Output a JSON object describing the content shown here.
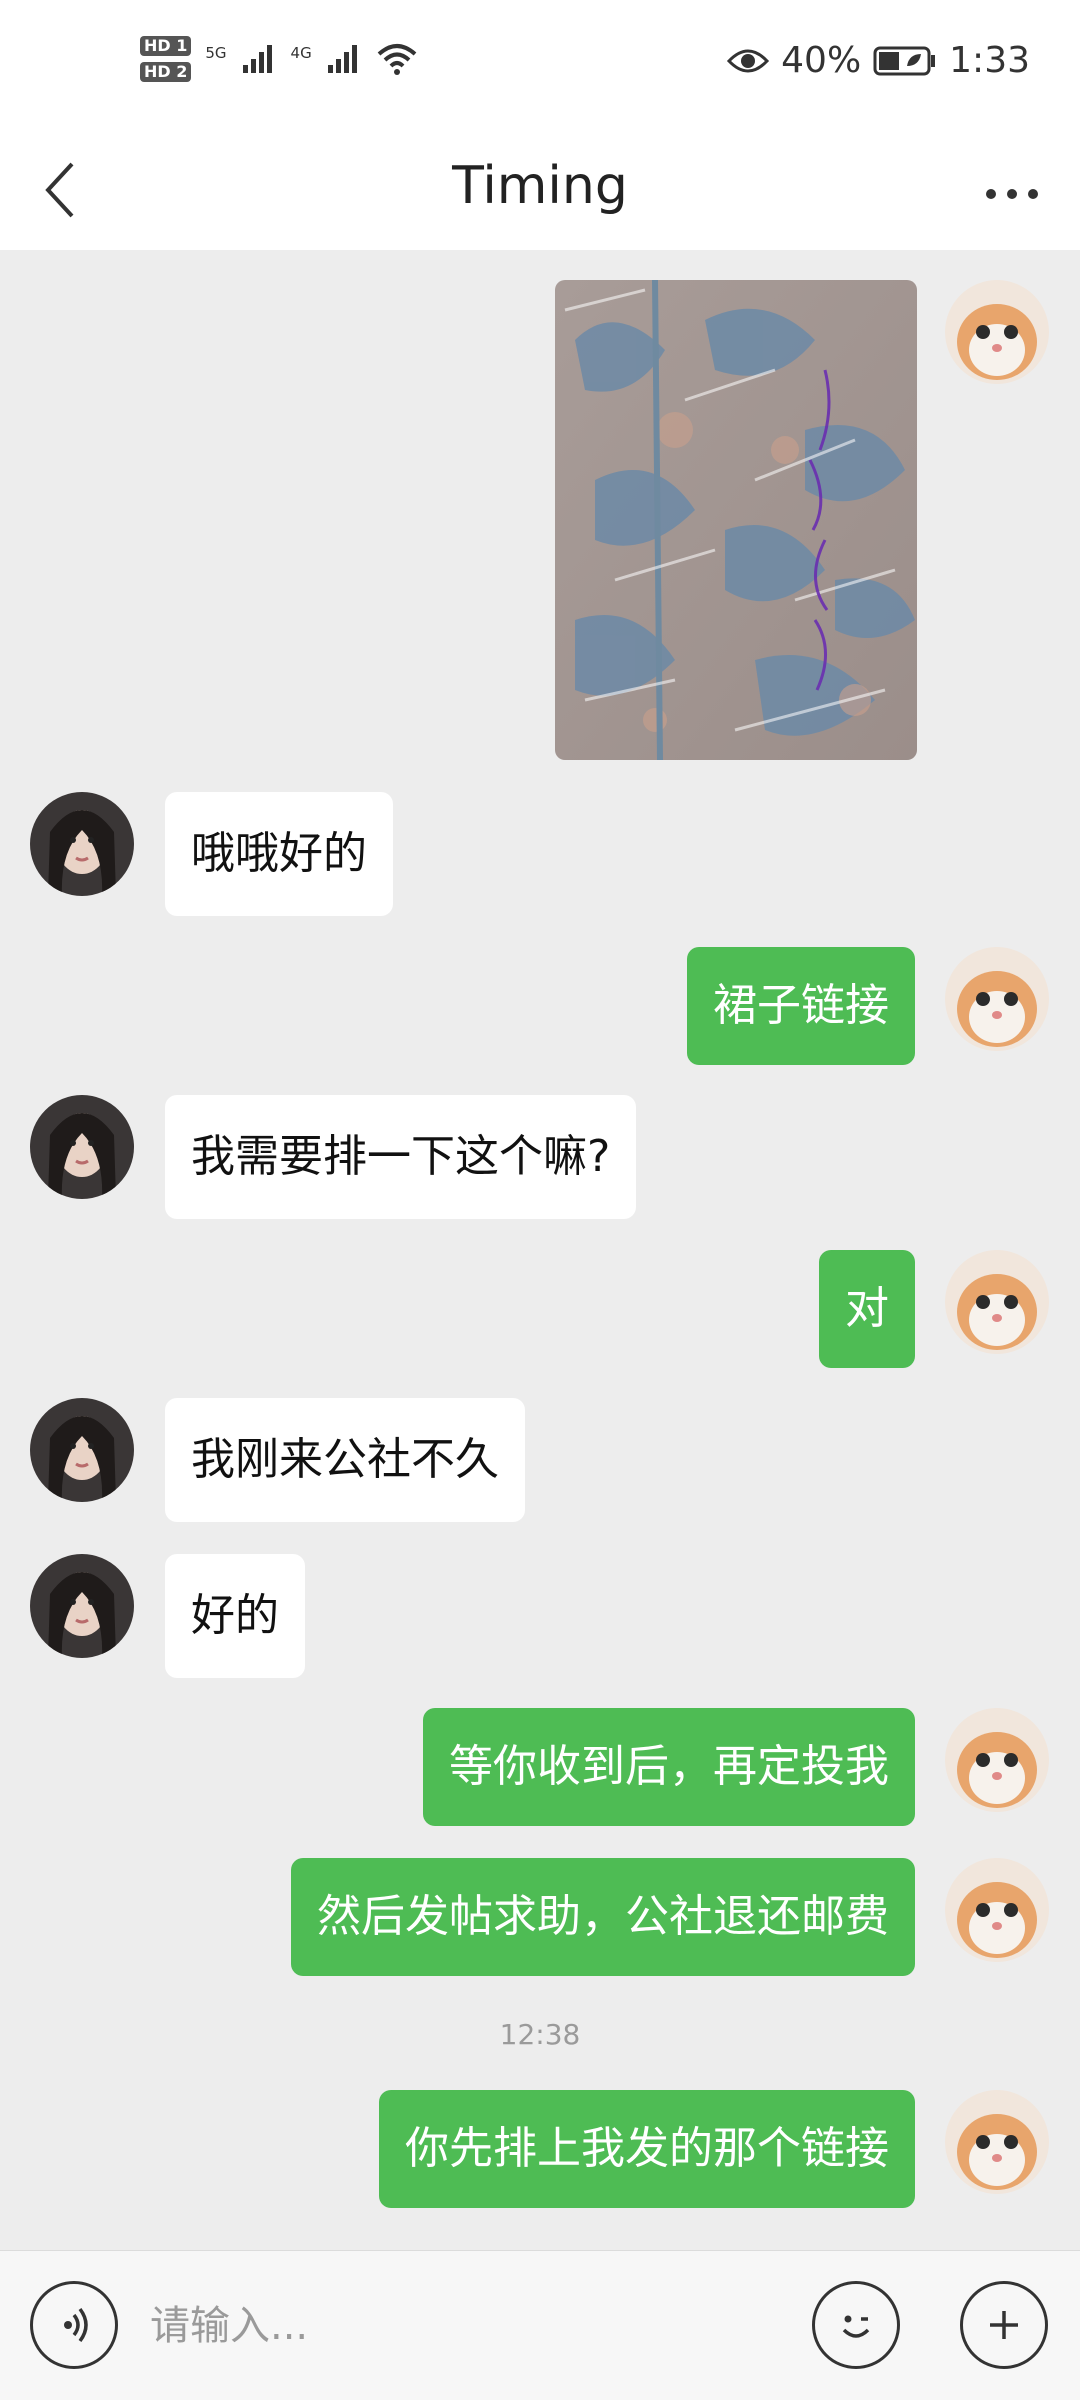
{
  "status_bar": {
    "sim1": "HD 1",
    "sim2": "HD 2",
    "network1": "5G",
    "network2": "4G",
    "battery": "40%",
    "time": "1:33",
    "icons": [
      "signal-icon",
      "wifi-icon",
      "eye-icon",
      "battery-icon"
    ]
  },
  "header": {
    "title": "Timing",
    "back_icon": "chevron-left-icon",
    "more_icon": "more-dots-icon"
  },
  "messages": [
    {
      "side": "out",
      "type": "image",
      "content": "photo of patterned fabric in plastic bag",
      "sender": "me"
    },
    {
      "side": "in",
      "type": "text",
      "text": "哦哦好的"
    },
    {
      "side": "out",
      "type": "text",
      "text": "裙子链接"
    },
    {
      "side": "in",
      "type": "text",
      "text": "我需要排一下这个嘛?"
    },
    {
      "side": "out",
      "type": "text",
      "text": "对"
    },
    {
      "side": "in",
      "type": "text",
      "text": "我刚来公社不久"
    },
    {
      "side": "in",
      "type": "text",
      "text": "好的"
    },
    {
      "side": "out",
      "type": "text",
      "text": "等你收到后，再定投我"
    },
    {
      "side": "out",
      "type": "text",
      "text": "然后发帖求助，公社退还邮费"
    },
    {
      "side": "time",
      "type": "timestamp",
      "text": "12:38"
    },
    {
      "side": "out",
      "type": "text",
      "text": "你先排上我发的那个链接"
    }
  ],
  "input": {
    "placeholder": "请输入..."
  },
  "colors": {
    "out_bubble": "#4ebc54",
    "in_bubble": "#ffffff",
    "background": "#ededed"
  }
}
